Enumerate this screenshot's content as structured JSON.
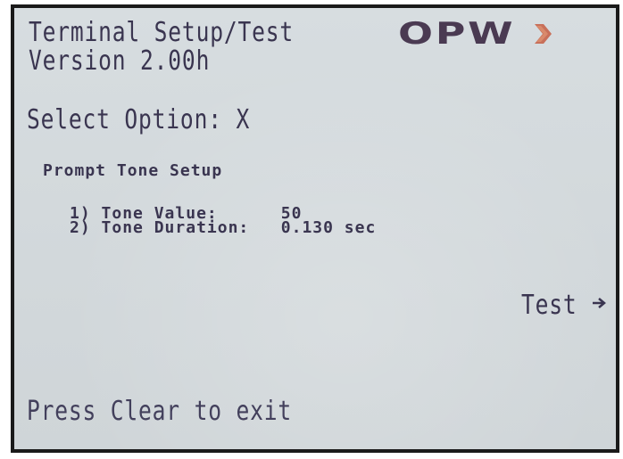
{
  "header": {
    "title": "Terminal Setup/Test",
    "version": "Version 2.00h",
    "logo_text": "OPW"
  },
  "prompt": {
    "select_option": "Select Option: X"
  },
  "section": {
    "title": "Prompt Tone Setup",
    "items": [
      {
        "number": "1)",
        "label": "Tone Value:",
        "value": "50"
      },
      {
        "number": "2)",
        "label": "Tone Duration:",
        "value": "0.130 sec"
      }
    ]
  },
  "softkeys": {
    "test_label": "Test",
    "test_icon": "right-arrow-icon"
  },
  "footer": {
    "exit_text": "Press Clear to exit"
  },
  "colors": {
    "lcd_background": "#d5dbde",
    "lcd_text": "#3a3550",
    "logo": "#4a3a52",
    "logo_arrow": "#c8705a",
    "bezel": "#1a1a1a"
  }
}
